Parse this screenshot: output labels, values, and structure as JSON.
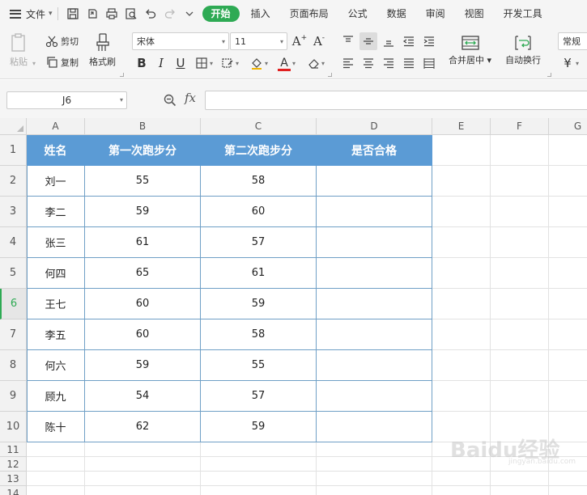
{
  "menubar": {
    "file_label": "文件",
    "tabs": [
      "开始",
      "插入",
      "页面布局",
      "公式",
      "数据",
      "审阅",
      "视图",
      "开发工具"
    ],
    "active_tab": "开始"
  },
  "ribbon": {
    "paste": "粘贴",
    "cut": "剪切",
    "copy": "复制",
    "format_painter": "格式刷",
    "font_name": "宋体",
    "font_size": "11",
    "merge_center": "合并居中",
    "wrap_text": "自动换行",
    "number_format": "常规",
    "currency_symbol": "¥",
    "bold": "B",
    "italic": "I",
    "underline": "U",
    "font_color_letter": "A",
    "grow_font": "A",
    "shrink_font": "A"
  },
  "formula_bar": {
    "cell_ref": "J6",
    "fx": "fx",
    "value": ""
  },
  "columns": [
    "A",
    "B",
    "C",
    "D",
    "E",
    "F",
    "G"
  ],
  "rows": [
    "1",
    "2",
    "3",
    "4",
    "5",
    "6",
    "7",
    "8",
    "9",
    "10",
    "11",
    "12",
    "13",
    "14"
  ],
  "selected_row": "6",
  "table": {
    "headers": [
      "姓名",
      "第一次跑步分",
      "第二次跑步分",
      "是否合格"
    ],
    "data": [
      [
        "刘一",
        "55",
        "58",
        ""
      ],
      [
        "李二",
        "59",
        "60",
        ""
      ],
      [
        "张三",
        "61",
        "57",
        ""
      ],
      [
        "何四",
        "65",
        "61",
        ""
      ],
      [
        "王七",
        "60",
        "59",
        ""
      ],
      [
        "李五",
        "60",
        "58",
        ""
      ],
      [
        "何六",
        "59",
        "55",
        ""
      ],
      [
        "顾九",
        "54",
        "57",
        ""
      ],
      [
        "陈十",
        "62",
        "59",
        ""
      ]
    ]
  },
  "colors": {
    "accent_green": "#2eaa54",
    "header_fill": "#5b9bd5",
    "table_border": "#6f9fc6"
  },
  "watermark": {
    "text": "Baidu经验",
    "sub": "jingyan.baidu.com"
  }
}
